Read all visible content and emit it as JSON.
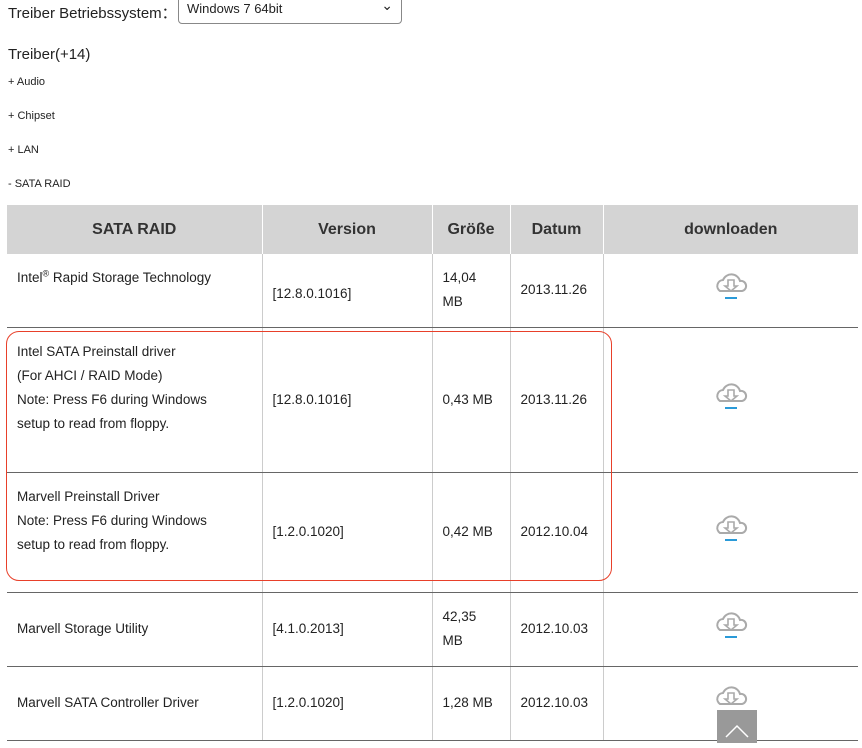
{
  "os": {
    "label": "Treiber Betriebssystem：",
    "selected": "Windows 7 64bit"
  },
  "drivers_title": "Treiber(+14)",
  "categories": [
    "+ Audio",
    "+ Chipset",
    "+ LAN",
    "- SATA RAID"
  ],
  "table": {
    "headers": [
      "SATA RAID",
      "Version",
      "Größe",
      "Datum",
      "downloaden"
    ],
    "rows": [
      {
        "name": "Intel",
        "sup": "®",
        "name_rest": " Rapid Storage Technology",
        "version": "[12.8.0.1016]",
        "size": "14,04 MB",
        "date": "2013.11.26"
      },
      {
        "lines": [
          "Intel SATA Preinstall driver",
          "(For AHCI / RAID Mode)",
          "Note: Press F6 during Windows",
          "setup to read from floppy."
        ],
        "version": "[12.8.0.1016]",
        "size": "0,43 MB",
        "date": "2013.11.26"
      },
      {
        "lines": [
          "Marvell Preinstall Driver",
          "Note: Press F6 during Windows",
          "setup to read from floppy."
        ],
        "version": "[1.2.0.1020]",
        "size": "0,42 MB",
        "date": "2012.10.04"
      },
      {
        "name": "Marvell Storage Utility",
        "version": "[4.1.0.2013]",
        "size": "42,35 MB",
        "date": "2012.10.03"
      },
      {
        "name": "Marvell SATA Controller Driver",
        "version": "[1.2.0.1020]",
        "size": "1,28 MB",
        "date": "2012.10.03"
      }
    ]
  },
  "colors": {
    "highlight": "#e8402a",
    "accent": "#2a9ad8",
    "header_bg": "#d4d4d4"
  }
}
